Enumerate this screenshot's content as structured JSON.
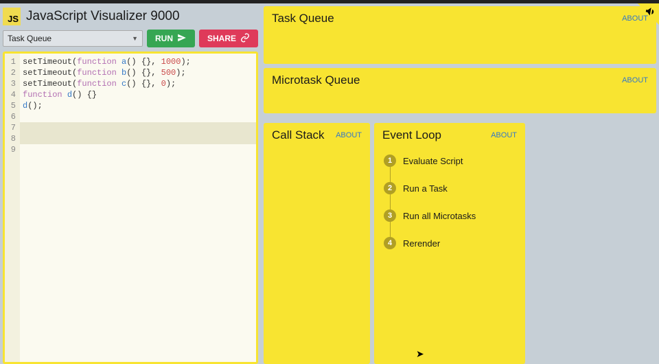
{
  "app_title": "JavaScript Visualizer 9000",
  "controls": {
    "select_label": "Task Queue",
    "run_label": "RUN",
    "share_label": "SHARE"
  },
  "code": {
    "lines": [
      {
        "n": 1,
        "tokens": [
          [
            "def",
            "setTimeout("
          ],
          [
            "kw",
            "function"
          ],
          [
            "def",
            " "
          ],
          [
            "fn",
            "a"
          ],
          [
            "def",
            "() {}, "
          ],
          [
            "num",
            "1000"
          ],
          [
            "def",
            ");"
          ]
        ]
      },
      {
        "n": 2,
        "tokens": [
          [
            "def",
            ""
          ]
        ]
      },
      {
        "n": 3,
        "tokens": [
          [
            "def",
            "setTimeout("
          ],
          [
            "kw",
            "function"
          ],
          [
            "def",
            " "
          ],
          [
            "fn",
            "b"
          ],
          [
            "def",
            "() {}, "
          ],
          [
            "num",
            "500"
          ],
          [
            "def",
            ");"
          ]
        ]
      },
      {
        "n": 4,
        "tokens": [
          [
            "def",
            ""
          ]
        ]
      },
      {
        "n": 5,
        "tokens": [
          [
            "def",
            "setTimeout("
          ],
          [
            "kw",
            "function"
          ],
          [
            "def",
            " "
          ],
          [
            "fn",
            "c"
          ],
          [
            "def",
            "() {}, "
          ],
          [
            "num",
            "0"
          ],
          [
            "def",
            ");"
          ]
        ]
      },
      {
        "n": 6,
        "tokens": [
          [
            "def",
            ""
          ]
        ]
      },
      {
        "n": 7,
        "tokens": [
          [
            "kw",
            "function"
          ],
          [
            "def",
            " "
          ],
          [
            "fn",
            "d"
          ],
          [
            "def",
            "() {}"
          ]
        ]
      },
      {
        "n": 8,
        "tokens": [
          [
            "def",
            ""
          ]
        ]
      },
      {
        "n": 9,
        "tokens": [
          [
            "fn",
            "d"
          ],
          [
            "def",
            "();"
          ]
        ]
      }
    ],
    "highlight_line": 7
  },
  "panels": {
    "task_queue": {
      "title": "Task Queue",
      "about": "ABOUT"
    },
    "microtask_queue": {
      "title": "Microtask Queue",
      "about": "ABOUT"
    },
    "call_stack": {
      "title": "Call Stack",
      "about": "ABOUT"
    },
    "event_loop": {
      "title": "Event Loop",
      "about": "ABOUT",
      "steps": [
        "Evaluate Script",
        "Run a Task",
        "Run all Microtasks",
        "Rerender"
      ]
    }
  }
}
